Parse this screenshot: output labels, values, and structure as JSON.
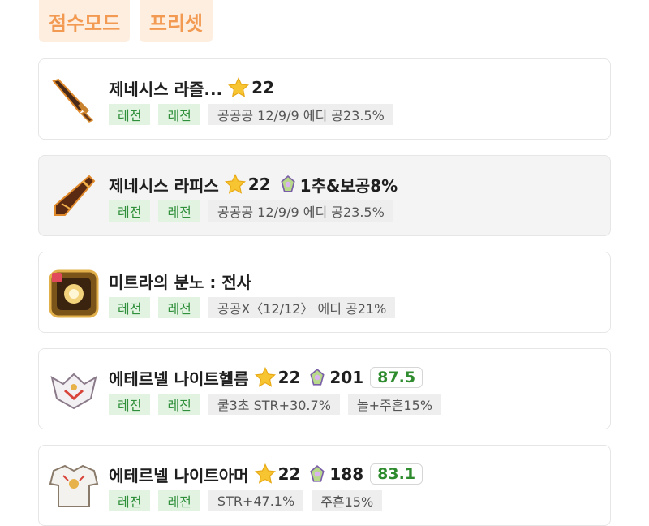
{
  "top": {
    "score_mode": "점수모드",
    "preset": "프리셋"
  },
  "items": [
    {
      "name": "제네시스 라즐...",
      "star": "22",
      "tags": [
        "레전",
        "레전"
      ],
      "stat": "공공공 12/9/9 에디 공23.5%"
    },
    {
      "name": "제네시스 라피스",
      "star": "22",
      "bonus": "1추&보공8%",
      "tags": [
        "레전",
        "레전"
      ],
      "stat": "공공공 12/9/9 에디 공23.5%"
    },
    {
      "name": "미트라의 분노 : 전사",
      "tags": [
        "레전",
        "레전"
      ],
      "stat": "공공X〈12/12〉 에디 공21%"
    },
    {
      "name": "에테르넬 나이트헬름",
      "star": "22",
      "bonus": "201",
      "score": "87.5",
      "tags": [
        "레전",
        "레전"
      ],
      "stat": "쿨3초 STR+30.7%",
      "stat2": "놀+주흔15%"
    },
    {
      "name": "에테르넬 나이트아머",
      "star": "22",
      "bonus": "188",
      "score": "83.1",
      "tags": [
        "레전",
        "레전"
      ],
      "stat": "STR+47.1%",
      "stat2": "주흔15%"
    }
  ],
  "colors": {
    "accent": "#f39a52",
    "legend_tag": "#2f8f3a",
    "score": "#2e8b2e"
  },
  "icons": {
    "star": "star-icon",
    "gem": "soul-gem-icon"
  }
}
